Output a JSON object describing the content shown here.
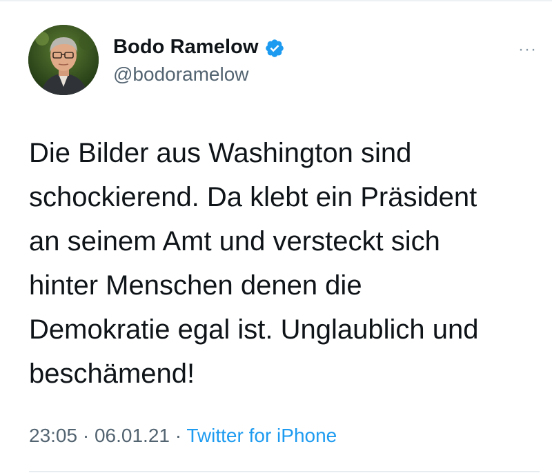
{
  "author": {
    "display_name": "Bodo Ramelow",
    "handle": "@bodoramelow",
    "verified": true,
    "avatar_icon": "profile-photo"
  },
  "tweet": {
    "lines": [
      "Die Bilder aus Washington sind",
      "schockierend. Da klebt ein Präsident",
      "an seinem Amt und versteckt sich",
      "hinter Menschen denen die",
      "Demokratie egal ist. Unglaublich und",
      "beschämend!"
    ]
  },
  "meta": {
    "time": "23:05",
    "separator1": " · ",
    "date": "06.01.21",
    "separator2": " · ",
    "source": "Twitter for iPhone"
  },
  "more_menu": {
    "label": "···"
  },
  "colors": {
    "verified_badge": "#1d9bf0",
    "link": "#1d9bf0",
    "secondary_text": "#536471",
    "primary_text": "#0f1419"
  }
}
